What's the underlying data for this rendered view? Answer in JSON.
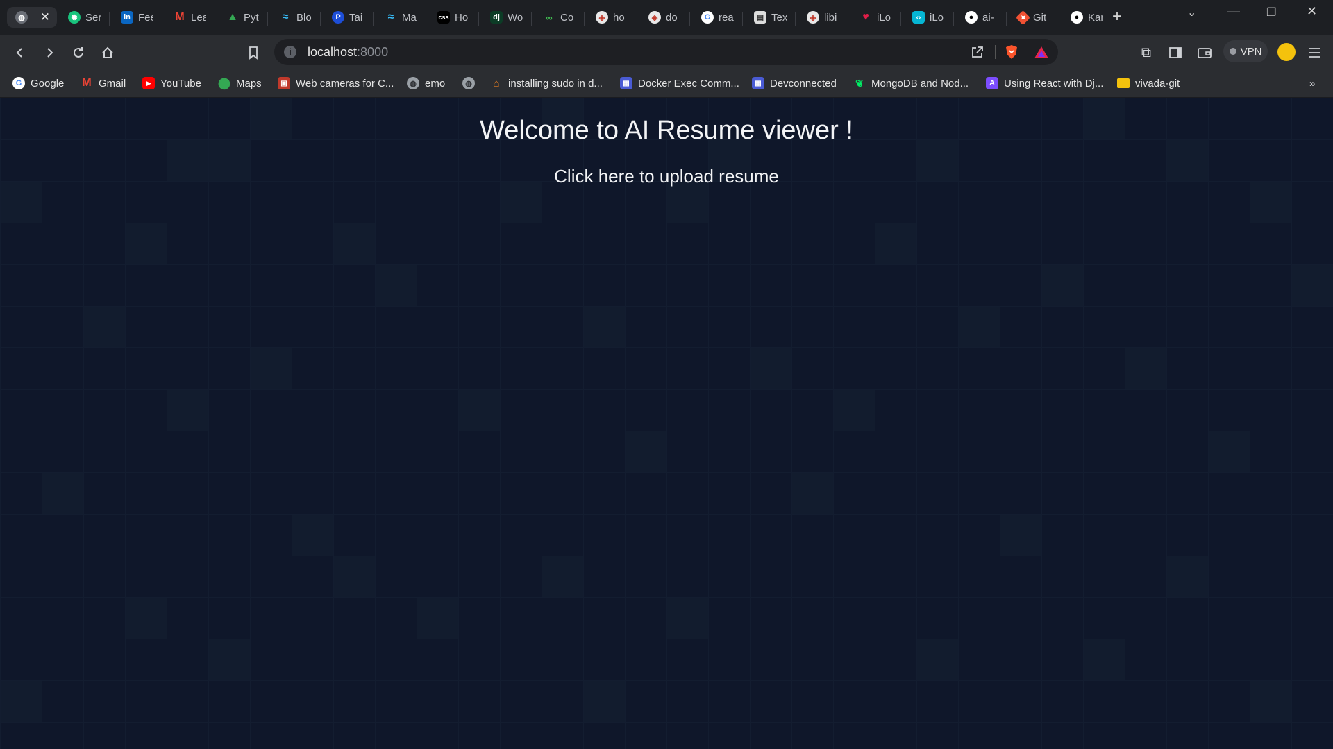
{
  "browser": {
    "tabs": [
      {
        "title": "",
        "icon": "globe-icon",
        "active": true
      },
      {
        "title": "Ser",
        "icon": "openai-icon"
      },
      {
        "title": "Fee",
        "icon": "linkedin-icon"
      },
      {
        "title": "Lea",
        "icon": "gmail-icon"
      },
      {
        "title": "Pyt",
        "icon": "google-drive-icon"
      },
      {
        "title": "Blo",
        "icon": "tailwind-icon"
      },
      {
        "title": "Tai",
        "icon": "tailwind-blue-icon"
      },
      {
        "title": "Ma",
        "icon": "tailwind-icon"
      },
      {
        "title": "Ho",
        "icon": "css-icon"
      },
      {
        "title": "Wo",
        "icon": "django-icon"
      },
      {
        "title": "Co",
        "icon": "link-icon"
      },
      {
        "title": "ho",
        "icon": "brave-shield-icon"
      },
      {
        "title": "do",
        "icon": "brave-shield-icon"
      },
      {
        "title": "rea",
        "icon": "google-icon"
      },
      {
        "title": "Tex",
        "icon": "document-icon"
      },
      {
        "title": "libi",
        "icon": "brave-shield-icon"
      },
      {
        "title": "iLo",
        "icon": "heart-icon"
      },
      {
        "title": "iLo",
        "icon": "code-icon"
      },
      {
        "title": "ai-",
        "icon": "github-icon"
      },
      {
        "title": "Git",
        "icon": "git-icon"
      },
      {
        "title": "Kar",
        "icon": "github-icon"
      }
    ],
    "new_tab_label": "+",
    "url_host": "localhost",
    "url_port": ":8000",
    "vpn_label": "VPN",
    "more_bookmarks": "»",
    "bookmarks": [
      {
        "label": "Google",
        "icon": "google-icon"
      },
      {
        "label": "Gmail",
        "icon": "gmail-icon"
      },
      {
        "label": "YouTube",
        "icon": "youtube-icon"
      },
      {
        "label": "Maps",
        "icon": "maps-icon"
      },
      {
        "label": "Web cameras for C...",
        "icon": "webcam-site-icon"
      },
      {
        "label": "emo",
        "icon": "globe-icon"
      },
      {
        "label": "",
        "icon": "globe-icon"
      },
      {
        "label": "installing sudo in d...",
        "icon": "hat-icon"
      },
      {
        "label": "Docker Exec Comm...",
        "icon": "docker-doc-icon"
      },
      {
        "label": "Devconnected",
        "icon": "docker-doc-icon"
      },
      {
        "label": "MongoDB and Nod...",
        "icon": "mongodb-icon"
      },
      {
        "label": "Using React with Dj...",
        "icon": "astro-icon"
      },
      {
        "label": "vivada-git",
        "icon": "folder-icon"
      }
    ]
  },
  "page": {
    "heading": "Welcome to AI Resume viewer !",
    "upload_link": "Click here to upload resume"
  }
}
